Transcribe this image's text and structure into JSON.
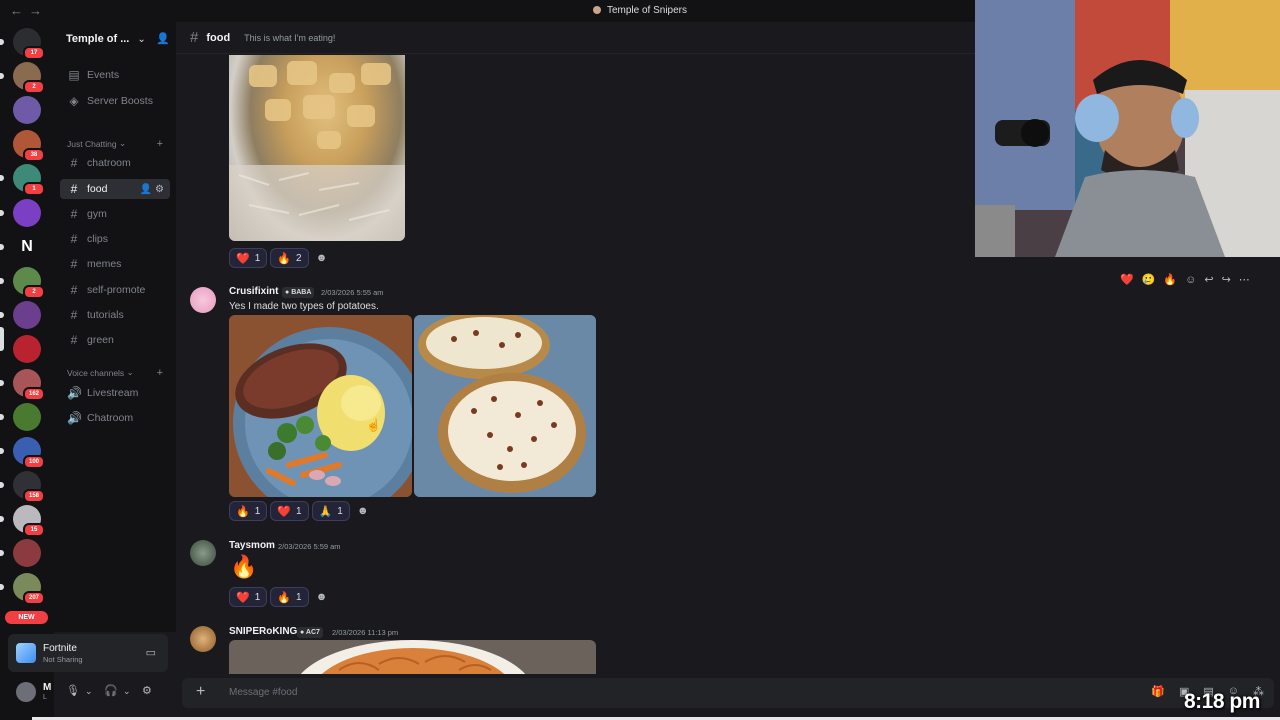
{
  "titlebar": {
    "title": "Temple of Snipers",
    "nav": "←→"
  },
  "rail": {
    "servers": [
      {
        "badge": "17",
        "color": "#2b2d31"
      },
      {
        "badge": "2",
        "color": "#8a6b4f"
      },
      {
        "badge": "",
        "color": "#6f5aa8"
      },
      {
        "badge": "38",
        "color": "#b0573a"
      },
      {
        "badge": "1",
        "color": "#3d8a78"
      },
      {
        "badge": "",
        "color": "#7b3fc4"
      },
      {
        "badge": "",
        "color": "#121214"
      },
      {
        "badge": "2",
        "color": "#5d8a4a"
      },
      {
        "badge": "",
        "color": "#6b3e8e"
      },
      {
        "badge": "",
        "color": "#b8232f"
      },
      {
        "badge": "162",
        "color": "#a8555a"
      },
      {
        "badge": "",
        "color": "#4a7a2f"
      },
      {
        "badge": "100",
        "color": "#3b5fb0"
      },
      {
        "badge": "158",
        "color": "#2f3136"
      },
      {
        "badge": "15",
        "color": "#b9b9be"
      },
      {
        "badge": "",
        "color": "#8b3a3f"
      },
      {
        "badge": "207",
        "color": "#7a8a5a"
      }
    ],
    "new_label": "NEW"
  },
  "sidebar": {
    "server_name": "Temple of ...",
    "top_items": [
      {
        "label": "Events",
        "icon": "calendar-icon"
      },
      {
        "label": "Server Boosts",
        "icon": "boost-icon"
      }
    ],
    "category1": "Just Chatting",
    "text_channels": [
      "chatroom",
      "food",
      "gym",
      "clips",
      "memes",
      "self-promote",
      "tutorials",
      "green"
    ],
    "active_channel": "food",
    "category2": "Voice channels",
    "voice_channels": [
      "Livestream",
      "Chatroom"
    ]
  },
  "activity": {
    "game": "Fortnite",
    "status": "Not Sharing"
  },
  "user": {
    "name": "M",
    "sub": "L"
  },
  "header": {
    "channel": "food",
    "topic": "This is what I'm eating!"
  },
  "messages": [
    {
      "reactions": [
        {
          "emoji": "❤️",
          "count": "1"
        },
        {
          "emoji": "🔥",
          "count": "2"
        }
      ]
    },
    {
      "user": "Crusifixint",
      "tag": "BABA",
      "time": "2/03/2026 5:55 am",
      "text": "Yes I made two types of potatoes.",
      "reactions": [
        {
          "emoji": "🔥",
          "count": "1"
        },
        {
          "emoji": "❤️",
          "count": "1"
        },
        {
          "emoji": "🙏",
          "count": "1"
        }
      ]
    },
    {
      "user": "Taysmom",
      "time": "2/03/2026 5:59 am",
      "big_emoji": "🔥",
      "reactions": [
        {
          "emoji": "❤️",
          "count": "1"
        },
        {
          "emoji": "🔥",
          "count": "1"
        }
      ]
    },
    {
      "user": "SNIPERoKING",
      "tag": "AC7",
      "time": "2/03/2026 11:13 pm"
    }
  ],
  "hover_actions": [
    "❤️",
    "🥲",
    "🔥",
    "☺",
    "↩",
    "↪",
    "⋯"
  ],
  "composer": {
    "placeholder": "Message #food"
  },
  "clock": "8:18 pm",
  "colors": {
    "accent": "#5865f2",
    "badge": "#f23f43",
    "bg": "#1a1a1e"
  }
}
